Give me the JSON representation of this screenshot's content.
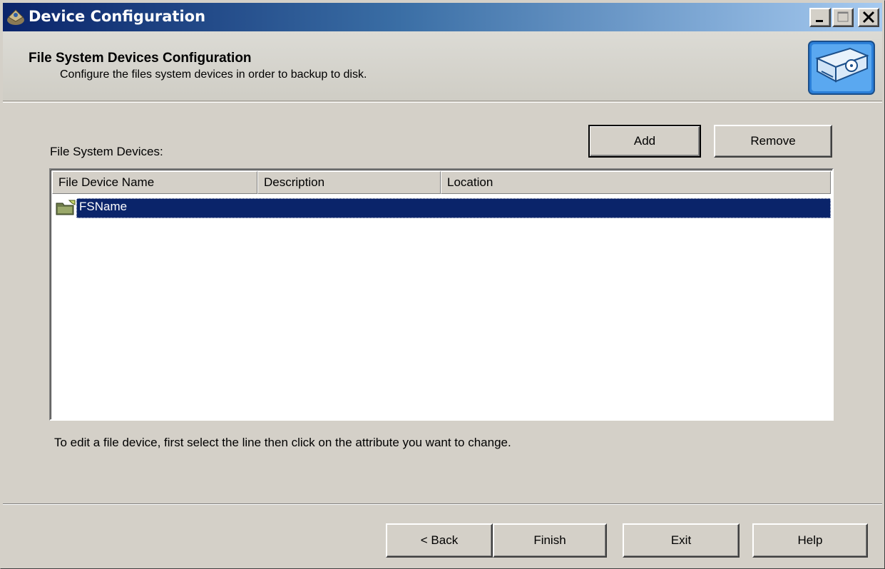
{
  "window": {
    "title": "Device Configuration"
  },
  "header": {
    "title": "File System Devices Configuration",
    "subtitle": "Configure the files system devices in order to backup to disk."
  },
  "devices_label": "File System Devices:",
  "buttons": {
    "add": "Add",
    "remove": "Remove",
    "back": "< Back",
    "finish": "Finish",
    "exit": "Exit",
    "help": "Help"
  },
  "list": {
    "columns": [
      "File Device Name",
      "Description",
      "Location"
    ],
    "rows": [
      {
        "name": "FSName",
        "description": "",
        "location": "",
        "selected": true
      }
    ]
  },
  "hint": "To edit a file device, first select the line then click on the attribute you want to change.",
  "colors": {
    "title_bar_start": "#0a246a",
    "title_bar_end": "#a6caf0",
    "selection": "#0a246a",
    "window_face": "#d4d0c8"
  }
}
